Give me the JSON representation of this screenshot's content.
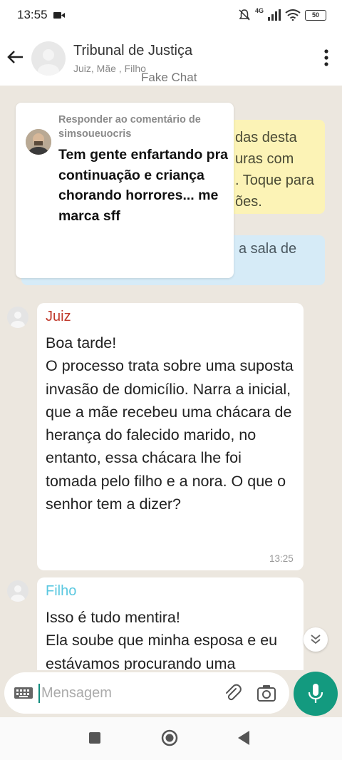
{
  "status_bar": {
    "time": "13:55",
    "network": "4G",
    "battery": "50"
  },
  "header": {
    "title": "Tribunal de Justiça",
    "subtitle": "Juiz, Mãe , Filho"
  },
  "watermark": "Fake Chat",
  "system_notices": {
    "yellow_text": "das desta\nuras com\n. Toque para\nões.",
    "blue_text": "a sala de"
  },
  "reply_card": {
    "heading": "Responder ao comentário de simsoueuocris",
    "body": "Tem gente enfartando pra continuação e criança chorando horrores... me marca sff"
  },
  "messages": [
    {
      "sender": "Juiz",
      "sender_color": "#c0392b",
      "text": "Boa tarde!\nO processo trata sobre uma suposta invasão de domicílio. Narra a inicial, que a mãe recebeu uma chácara de herança do falecido marido, no entanto, essa chácara lhe foi tomada pelo filho e a nora. O que o senhor tem a dizer?",
      "time": "13:25"
    },
    {
      "sender": "Filho",
      "sender_color": "#5bc8e0",
      "text": "Isso é tudo mentira!\nEla soube que minha esposa e eu estávamos procurando uma"
    }
  ],
  "composer": {
    "placeholder": "Mensagem"
  },
  "colors": {
    "accent": "#139a7f",
    "chat_background": "#ece7df",
    "yellow_notice": "#fcf3b6",
    "blue_notice": "#d6ebf7"
  }
}
